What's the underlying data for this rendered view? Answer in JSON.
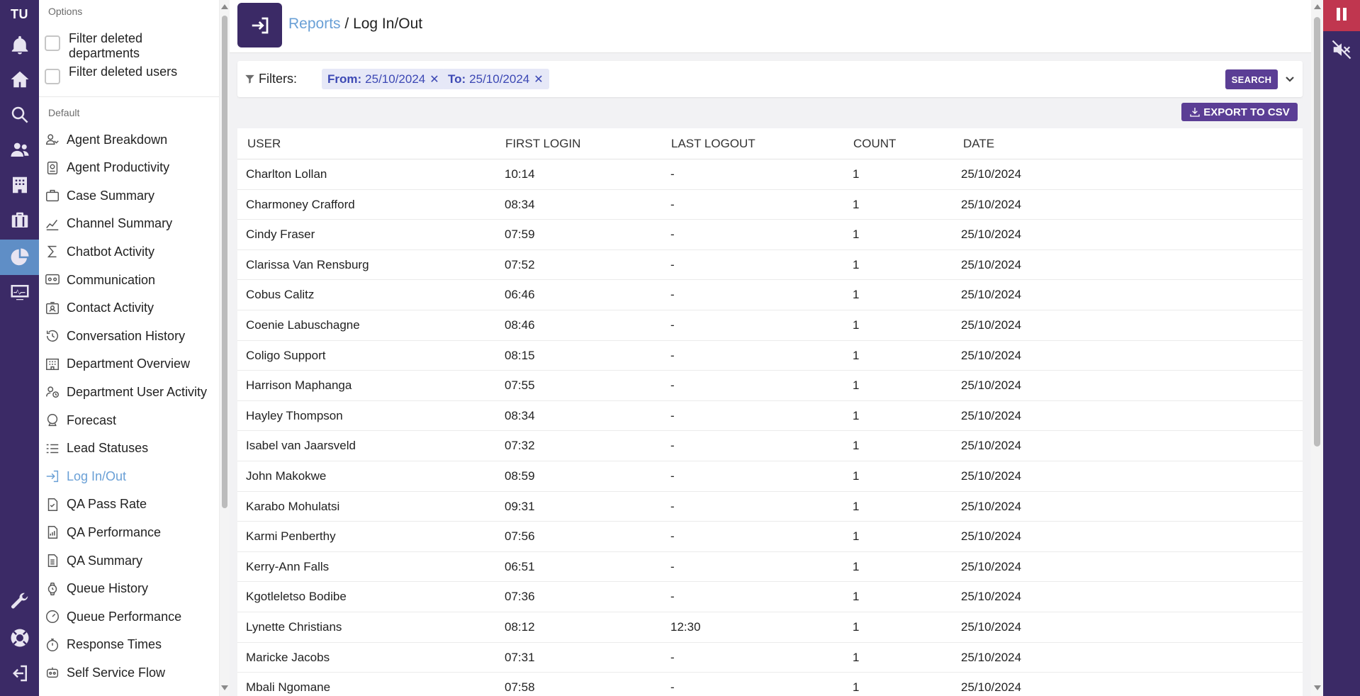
{
  "app": {
    "brand_initials": "TU"
  },
  "rail": {
    "items": [
      {
        "icon": "bell-icon",
        "active": false
      },
      {
        "icon": "home-icon",
        "active": false
      },
      {
        "icon": "search-icon",
        "active": false
      },
      {
        "icon": "users-icon",
        "active": false
      },
      {
        "icon": "building-icon",
        "active": false
      },
      {
        "icon": "briefcase-icon",
        "active": false
      },
      {
        "icon": "pie-chart-icon",
        "active": true
      },
      {
        "icon": "monitor-icon",
        "active": false
      },
      {
        "icon": "wrench-icon",
        "active": false
      },
      {
        "icon": "lifebuoy-icon",
        "active": false
      },
      {
        "icon": "logout-icon",
        "active": false
      }
    ]
  },
  "sidebar": {
    "options_heading": "Options",
    "checkboxes": [
      {
        "label": "Filter deleted departments",
        "checked": false
      },
      {
        "label": "Filter deleted users",
        "checked": false
      }
    ],
    "default_heading": "Default",
    "items": [
      {
        "label": "Agent Breakdown",
        "icon": "user-breakdown-icon",
        "active": false
      },
      {
        "label": "Agent Productivity",
        "icon": "badge-icon",
        "active": false
      },
      {
        "label": "Case Summary",
        "icon": "briefcase-icon",
        "active": false
      },
      {
        "label": "Channel Summary",
        "icon": "chart-line-icon",
        "active": false
      },
      {
        "label": "Chatbot Activity",
        "icon": "sigma-icon",
        "active": false
      },
      {
        "label": "Communication",
        "icon": "group-chat-icon",
        "active": false
      },
      {
        "label": "Contact Activity",
        "icon": "contact-card-icon",
        "active": false
      },
      {
        "label": "Conversation History",
        "icon": "history-icon",
        "active": false
      },
      {
        "label": "Department Overview",
        "icon": "building-icon",
        "active": false
      },
      {
        "label": "Department User Activity",
        "icon": "user-clock-icon",
        "active": false
      },
      {
        "label": "Forecast",
        "icon": "crystal-ball-icon",
        "active": false
      },
      {
        "label": "Lead Statuses",
        "icon": "list-status-icon",
        "active": false
      },
      {
        "label": "Log In/Out",
        "icon": "login-icon",
        "active": true
      },
      {
        "label": "QA Pass Rate",
        "icon": "doc-check-icon",
        "active": false
      },
      {
        "label": "QA Performance",
        "icon": "doc-chart-icon",
        "active": false
      },
      {
        "label": "QA Summary",
        "icon": "doc-list-icon",
        "active": false
      },
      {
        "label": "Queue History",
        "icon": "watch-icon",
        "active": false
      },
      {
        "label": "Queue Performance",
        "icon": "gauge-icon",
        "active": false
      },
      {
        "label": "Response Times",
        "icon": "stopwatch-icon",
        "active": false
      },
      {
        "label": "Self Service Flow",
        "icon": "robot-icon",
        "active": false
      }
    ]
  },
  "header": {
    "icon": "login-icon",
    "breadcrumb_link": "Reports",
    "breadcrumb_sep": "/",
    "breadcrumb_current": "Log In/Out"
  },
  "filters": {
    "label": "Filters:",
    "chips": [
      {
        "key": "From:",
        "value": "25/10/2024"
      },
      {
        "key": "To:",
        "value": "25/10/2024"
      }
    ],
    "search_label": "SEARCH"
  },
  "export_label": "EXPORT TO CSV",
  "table": {
    "columns": [
      "USER",
      "FIRST LOGIN",
      "LAST LOGOUT",
      "COUNT",
      "DATE"
    ],
    "rows": [
      [
        "Charlton Lollan",
        "10:14",
        "-",
        "1",
        "25/10/2024"
      ],
      [
        "Charmoney Crafford",
        "08:34",
        "-",
        "1",
        "25/10/2024"
      ],
      [
        "Cindy Fraser",
        "07:59",
        "-",
        "1",
        "25/10/2024"
      ],
      [
        "Clarissa Van Rensburg",
        "07:52",
        "-",
        "1",
        "25/10/2024"
      ],
      [
        "Cobus Calitz",
        "06:46",
        "-",
        "1",
        "25/10/2024"
      ],
      [
        "Coenie Labuschagne",
        "08:46",
        "-",
        "1",
        "25/10/2024"
      ],
      [
        "Coligo Support",
        "08:15",
        "-",
        "1",
        "25/10/2024"
      ],
      [
        "Harrison Maphanga",
        "07:55",
        "-",
        "1",
        "25/10/2024"
      ],
      [
        "Hayley Thompson",
        "08:34",
        "-",
        "1",
        "25/10/2024"
      ],
      [
        "Isabel van Jaarsveld",
        "07:32",
        "-",
        "1",
        "25/10/2024"
      ],
      [
        "John Makokwe",
        "08:59",
        "-",
        "1",
        "25/10/2024"
      ],
      [
        "Karabo Mohulatsi",
        "09:31",
        "-",
        "1",
        "25/10/2024"
      ],
      [
        "Karmi Penberthy",
        "07:56",
        "-",
        "1",
        "25/10/2024"
      ],
      [
        "Kerry-Ann Falls",
        "06:51",
        "-",
        "1",
        "25/10/2024"
      ],
      [
        "Kgotleletso Bodibe",
        "07:36",
        "-",
        "1",
        "25/10/2024"
      ],
      [
        "Lynette Christians",
        "08:12",
        "12:30",
        "1",
        "25/10/2024"
      ],
      [
        "Maricke Jacobs",
        "07:31",
        "-",
        "1",
        "25/10/2024"
      ],
      [
        "Mbali Ngomane",
        "07:58",
        "-",
        "1",
        "25/10/2024"
      ]
    ]
  },
  "right_rail": {
    "pause_icon": "pause-icon",
    "mute_icon": "volume-mute-icon"
  },
  "colors": {
    "brand_purple": "#3b2a66",
    "accent_purple": "#5b3e95",
    "link_blue": "#6aa0d6",
    "pause_red": "#c0364f"
  }
}
